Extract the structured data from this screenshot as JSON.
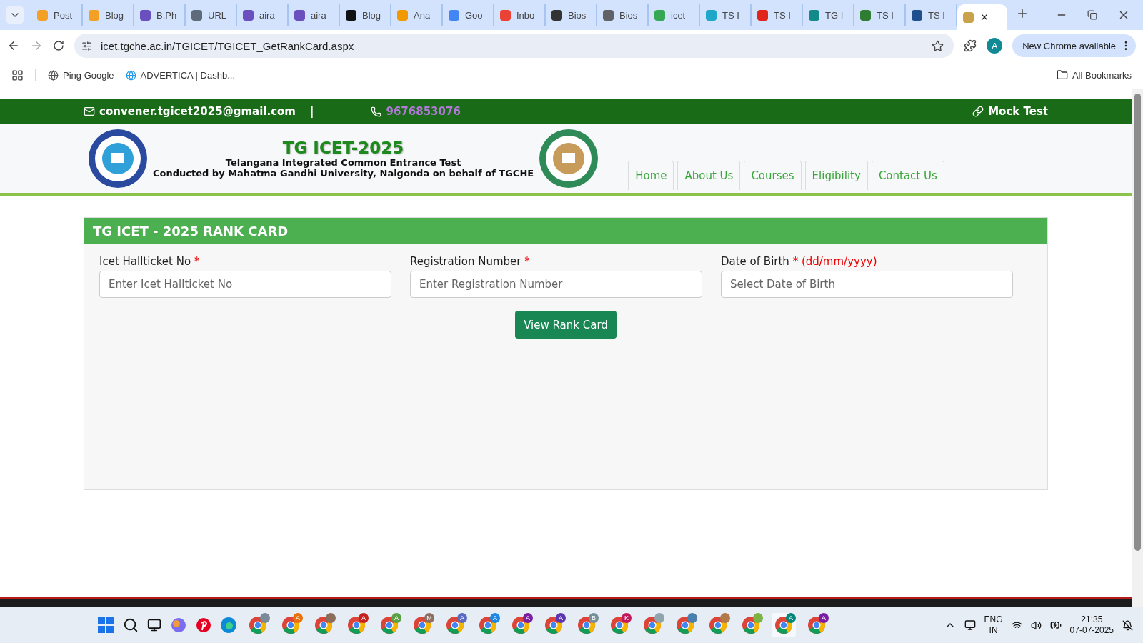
{
  "browser": {
    "tabs": [
      {
        "title": "Post",
        "color": "#f4a025",
        "selected": false
      },
      {
        "title": "Blog",
        "color": "#f4a025",
        "selected": false
      },
      {
        "title": "B.Ph",
        "color": "#6a4fbf",
        "selected": false
      },
      {
        "title": "URL",
        "color": "#5f6b7a",
        "selected": false
      },
      {
        "title": "aira",
        "color": "#6a4fbf",
        "selected": false
      },
      {
        "title": "aira",
        "color": "#6a4fbf",
        "selected": false
      },
      {
        "title": "Blog",
        "color": "#111111",
        "selected": false
      },
      {
        "title": "Ana",
        "color": "#f29900",
        "selected": false
      },
      {
        "title": "Goo",
        "color": "#4285f4",
        "selected": false
      },
      {
        "title": "Inbo",
        "color": "#ea4335",
        "selected": false
      },
      {
        "title": "Bios",
        "color": "#333333",
        "selected": false
      },
      {
        "title": "Bios",
        "color": "#5f6368",
        "selected": false
      },
      {
        "title": "icet",
        "color": "#34a853",
        "selected": false
      },
      {
        "title": "TS I",
        "color": "#1fa7c9",
        "selected": false
      },
      {
        "title": "TS I",
        "color": "#e1251b",
        "selected": false
      },
      {
        "title": "TG I",
        "color": "#138a8a",
        "selected": false
      },
      {
        "title": "TS I",
        "color": "#2e7d32",
        "selected": false
      },
      {
        "title": "TS I",
        "color": "#1e4e8c",
        "selected": false
      },
      {
        "color": "#c9a24b",
        "selected": true
      }
    ],
    "url": "icet.tgche.ac.in/TGICET/TGICET_GetRankCard.aspx",
    "profile": "A",
    "update": "New Chrome available",
    "bookmarks": [
      "Ping Google",
      "ADVERTICA | Dashb..."
    ],
    "all_bookmarks": "All Bookmarks"
  },
  "page": {
    "topbar": {
      "email": "convener.tgicet2025@gmail.com",
      "separator": "|",
      "phone": "9676853076",
      "link": "Mock Test"
    },
    "header": {
      "title": "TG ICET-2025",
      "subtitle": "Telangana Integrated Common Entrance Test",
      "conducted": "Conducted by Mahatma Gandhi University, Nalgonda on behalf of TGCHE"
    },
    "nav": [
      {
        "label": "Home"
      },
      {
        "label": "About Us"
      },
      {
        "label": "Courses"
      },
      {
        "label": "Eligibility"
      },
      {
        "label": "Contact Us"
      }
    ],
    "card": {
      "title": "TG ICET - 2025 RANK CARD",
      "fields": [
        {
          "label": "Icet Hallticket No",
          "required": "*",
          "placeholder": "Enter Icet Hallticket No"
        },
        {
          "label": "Registration Number",
          "required": "*",
          "placeholder": "Enter Registration Number"
        },
        {
          "label": "Date of Birth",
          "required": "* (dd/mm/yyyy)",
          "placeholder": "Select Date of Birth"
        }
      ],
      "button": "View Rank Card"
    }
  },
  "taskbar": {
    "apps": [
      {
        "kind": "chrome",
        "color": "#7a8a99"
      },
      {
        "kind": "chrome",
        "badge": "A",
        "color": "#e8710a"
      },
      {
        "kind": "chrome",
        "color": "#8a6d5a"
      },
      {
        "kind": "chrome",
        "badge": "A",
        "color": "#c5221f"
      },
      {
        "kind": "chrome",
        "badge": "A",
        "color": "#5aa045"
      },
      {
        "kind": "chrome",
        "badge": "M",
        "color": "#8d6e63"
      },
      {
        "kind": "chrome",
        "badge": "A",
        "color": "#5c6bc0"
      },
      {
        "kind": "chrome",
        "badge": "A",
        "color": "#1e88e5"
      },
      {
        "kind": "chrome",
        "badge": "A",
        "color": "#7b1fa2"
      },
      {
        "kind": "chrome",
        "badge": "A",
        "color": "#5e35b1"
      },
      {
        "kind": "chrome",
        "badge": "B",
        "color": "#78909c"
      },
      {
        "kind": "chrome",
        "badge": "K",
        "color": "#c2185b"
      },
      {
        "kind": "chrome",
        "color": "#90a4ae"
      },
      {
        "kind": "chrome",
        "color": "#4a7fb0"
      },
      {
        "kind": "chrome",
        "color": "#b07a4a"
      },
      {
        "kind": "chrome",
        "color": "#7cb342"
      },
      {
        "kind": "chrome",
        "badge": "A",
        "color": "#00897b",
        "selected": true
      },
      {
        "kind": "chrome",
        "badge": "A",
        "color": "#7b1fa2"
      }
    ],
    "lang": "ENG",
    "region": "IN",
    "time": "21:35",
    "date": "07-07-2025"
  }
}
